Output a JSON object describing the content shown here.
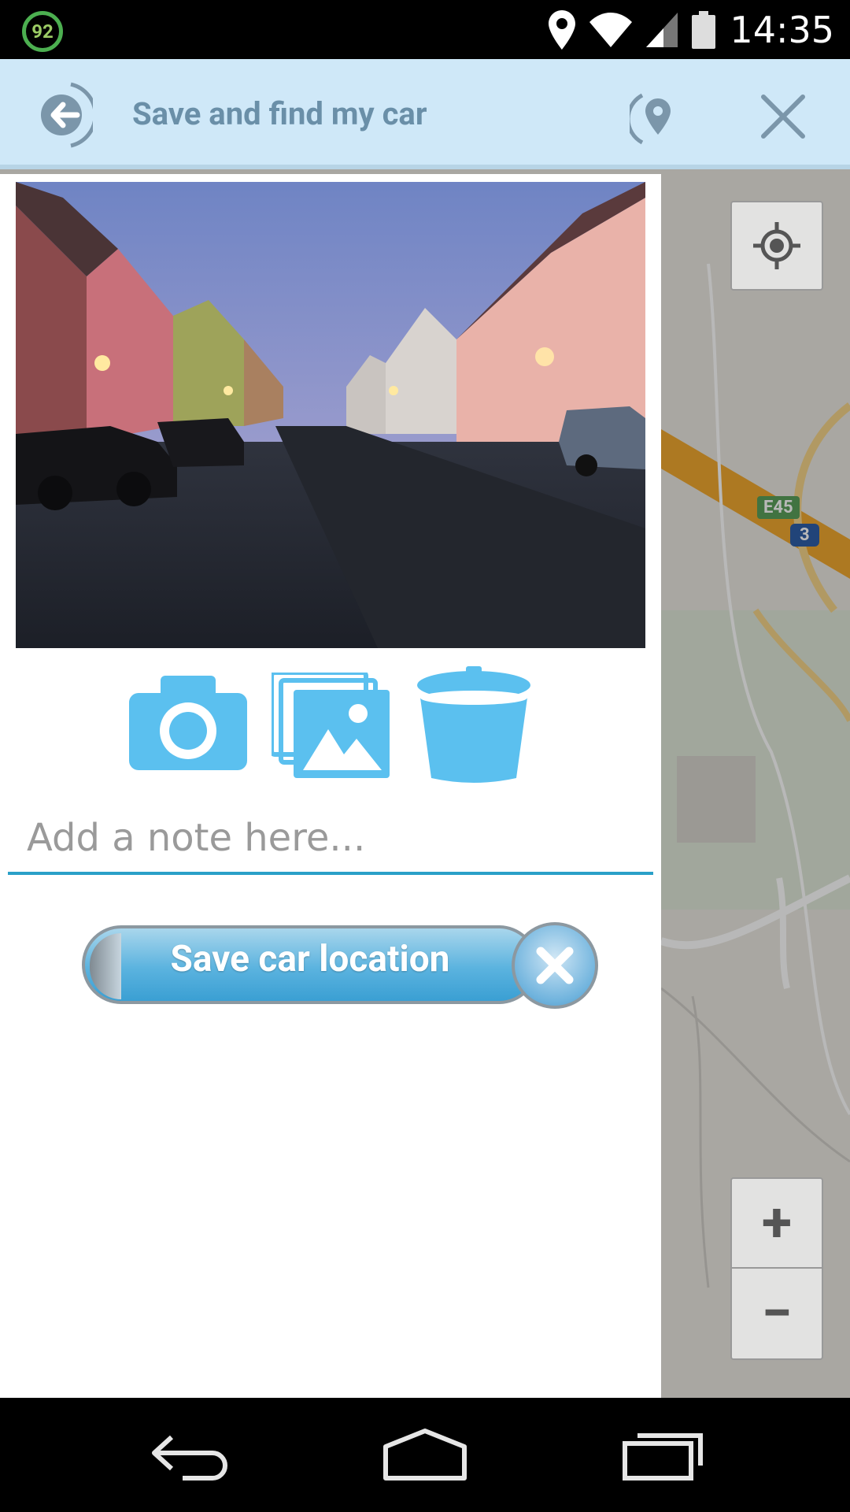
{
  "status_bar": {
    "badge": "92",
    "time": "14:35"
  },
  "action_bar": {
    "title": "Save and find my car"
  },
  "map": {
    "road_label_e45": "E45",
    "road_label_3": "3",
    "zoom_in": "+",
    "zoom_out": "−"
  },
  "panel": {
    "note_placeholder": "Add a note here...",
    "save_label": "Save car location"
  },
  "icons": {
    "accent": "#5bc0ef",
    "title_color": "#6a8fa8"
  }
}
